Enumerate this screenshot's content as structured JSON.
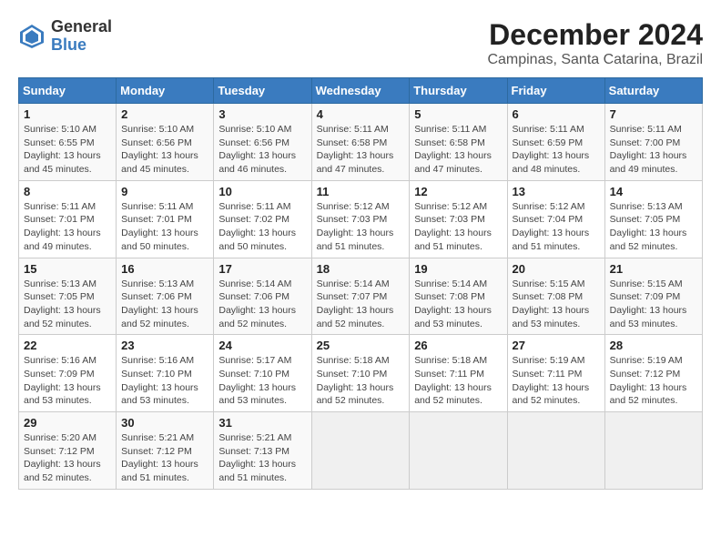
{
  "logo": {
    "line1": "General",
    "line2": "Blue"
  },
  "title": "December 2024",
  "subtitle": "Campinas, Santa Catarina, Brazil",
  "days_of_week": [
    "Sunday",
    "Monday",
    "Tuesday",
    "Wednesday",
    "Thursday",
    "Friday",
    "Saturday"
  ],
  "weeks": [
    [
      {
        "day": "1",
        "info": "Sunrise: 5:10 AM\nSunset: 6:55 PM\nDaylight: 13 hours\nand 45 minutes."
      },
      {
        "day": "2",
        "info": "Sunrise: 5:10 AM\nSunset: 6:56 PM\nDaylight: 13 hours\nand 45 minutes."
      },
      {
        "day": "3",
        "info": "Sunrise: 5:10 AM\nSunset: 6:56 PM\nDaylight: 13 hours\nand 46 minutes."
      },
      {
        "day": "4",
        "info": "Sunrise: 5:11 AM\nSunset: 6:58 PM\nDaylight: 13 hours\nand 47 minutes."
      },
      {
        "day": "5",
        "info": "Sunrise: 5:11 AM\nSunset: 6:58 PM\nDaylight: 13 hours\nand 47 minutes."
      },
      {
        "day": "6",
        "info": "Sunrise: 5:11 AM\nSunset: 6:59 PM\nDaylight: 13 hours\nand 48 minutes."
      },
      {
        "day": "7",
        "info": "Sunrise: 5:11 AM\nSunset: 7:00 PM\nDaylight: 13 hours\nand 49 minutes."
      }
    ],
    [
      {
        "day": "8",
        "info": "Sunrise: 5:11 AM\nSunset: 7:01 PM\nDaylight: 13 hours\nand 49 minutes."
      },
      {
        "day": "9",
        "info": "Sunrise: 5:11 AM\nSunset: 7:01 PM\nDaylight: 13 hours\nand 50 minutes."
      },
      {
        "day": "10",
        "info": "Sunrise: 5:11 AM\nSunset: 7:02 PM\nDaylight: 13 hours\nand 50 minutes."
      },
      {
        "day": "11",
        "info": "Sunrise: 5:12 AM\nSunset: 7:03 PM\nDaylight: 13 hours\nand 51 minutes."
      },
      {
        "day": "12",
        "info": "Sunrise: 5:12 AM\nSunset: 7:03 PM\nDaylight: 13 hours\nand 51 minutes."
      },
      {
        "day": "13",
        "info": "Sunrise: 5:12 AM\nSunset: 7:04 PM\nDaylight: 13 hours\nand 51 minutes."
      },
      {
        "day": "14",
        "info": "Sunrise: 5:13 AM\nSunset: 7:05 PM\nDaylight: 13 hours\nand 52 minutes."
      }
    ],
    [
      {
        "day": "15",
        "info": "Sunrise: 5:13 AM\nSunset: 7:05 PM\nDaylight: 13 hours\nand 52 minutes."
      },
      {
        "day": "16",
        "info": "Sunrise: 5:13 AM\nSunset: 7:06 PM\nDaylight: 13 hours\nand 52 minutes."
      },
      {
        "day": "17",
        "info": "Sunrise: 5:14 AM\nSunset: 7:06 PM\nDaylight: 13 hours\nand 52 minutes."
      },
      {
        "day": "18",
        "info": "Sunrise: 5:14 AM\nSunset: 7:07 PM\nDaylight: 13 hours\nand 52 minutes."
      },
      {
        "day": "19",
        "info": "Sunrise: 5:14 AM\nSunset: 7:08 PM\nDaylight: 13 hours\nand 53 minutes."
      },
      {
        "day": "20",
        "info": "Sunrise: 5:15 AM\nSunset: 7:08 PM\nDaylight: 13 hours\nand 53 minutes."
      },
      {
        "day": "21",
        "info": "Sunrise: 5:15 AM\nSunset: 7:09 PM\nDaylight: 13 hours\nand 53 minutes."
      }
    ],
    [
      {
        "day": "22",
        "info": "Sunrise: 5:16 AM\nSunset: 7:09 PM\nDaylight: 13 hours\nand 53 minutes."
      },
      {
        "day": "23",
        "info": "Sunrise: 5:16 AM\nSunset: 7:10 PM\nDaylight: 13 hours\nand 53 minutes."
      },
      {
        "day": "24",
        "info": "Sunrise: 5:17 AM\nSunset: 7:10 PM\nDaylight: 13 hours\nand 53 minutes."
      },
      {
        "day": "25",
        "info": "Sunrise: 5:18 AM\nSunset: 7:10 PM\nDaylight: 13 hours\nand 52 minutes."
      },
      {
        "day": "26",
        "info": "Sunrise: 5:18 AM\nSunset: 7:11 PM\nDaylight: 13 hours\nand 52 minutes."
      },
      {
        "day": "27",
        "info": "Sunrise: 5:19 AM\nSunset: 7:11 PM\nDaylight: 13 hours\nand 52 minutes."
      },
      {
        "day": "28",
        "info": "Sunrise: 5:19 AM\nSunset: 7:12 PM\nDaylight: 13 hours\nand 52 minutes."
      }
    ],
    [
      {
        "day": "29",
        "info": "Sunrise: 5:20 AM\nSunset: 7:12 PM\nDaylight: 13 hours\nand 52 minutes."
      },
      {
        "day": "30",
        "info": "Sunrise: 5:21 AM\nSunset: 7:12 PM\nDaylight: 13 hours\nand 51 minutes."
      },
      {
        "day": "31",
        "info": "Sunrise: 5:21 AM\nSunset: 7:13 PM\nDaylight: 13 hours\nand 51 minutes."
      },
      {
        "day": "",
        "info": ""
      },
      {
        "day": "",
        "info": ""
      },
      {
        "day": "",
        "info": ""
      },
      {
        "day": "",
        "info": ""
      }
    ]
  ]
}
